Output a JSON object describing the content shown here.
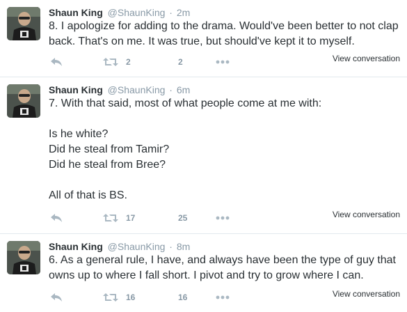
{
  "tweets": [
    {
      "fullname": "Shaun King",
      "username": "@ShaunKing",
      "separator": "·",
      "time": "2m",
      "text": "8. I apologize for adding to the drama. Would've been better to not clap back. That's on me. It was true, but should've kept it to myself.",
      "retweets": "2",
      "favorites": "2",
      "view_conversation": "View conversation"
    },
    {
      "fullname": "Shaun King",
      "username": "@ShaunKing",
      "separator": "·",
      "time": "6m",
      "text": "7. With that said, most of what people come at me with:\n\nIs he white?\nDid he steal from Tamir?\nDid he steal from Bree?\n\nAll of that is BS.",
      "retweets": "17",
      "favorites": "25",
      "view_conversation": "View conversation"
    },
    {
      "fullname": "Shaun King",
      "username": "@ShaunKing",
      "separator": "·",
      "time": "8m",
      "text": "6. As a general rule, I have, and always have been the type of guy that owns up to where I fall short. I pivot and try to grow where I can.",
      "retweets": "16",
      "favorites": "16",
      "view_conversation": "View conversation"
    }
  ],
  "icons": {
    "reply": "reply-icon",
    "retweet": "retweet-icon",
    "more": "more-dots-icon"
  },
  "colors": {
    "text": "#292f33",
    "muted": "#8899a6",
    "icon": "#aab8c2",
    "divider": "#e1e8ed"
  }
}
